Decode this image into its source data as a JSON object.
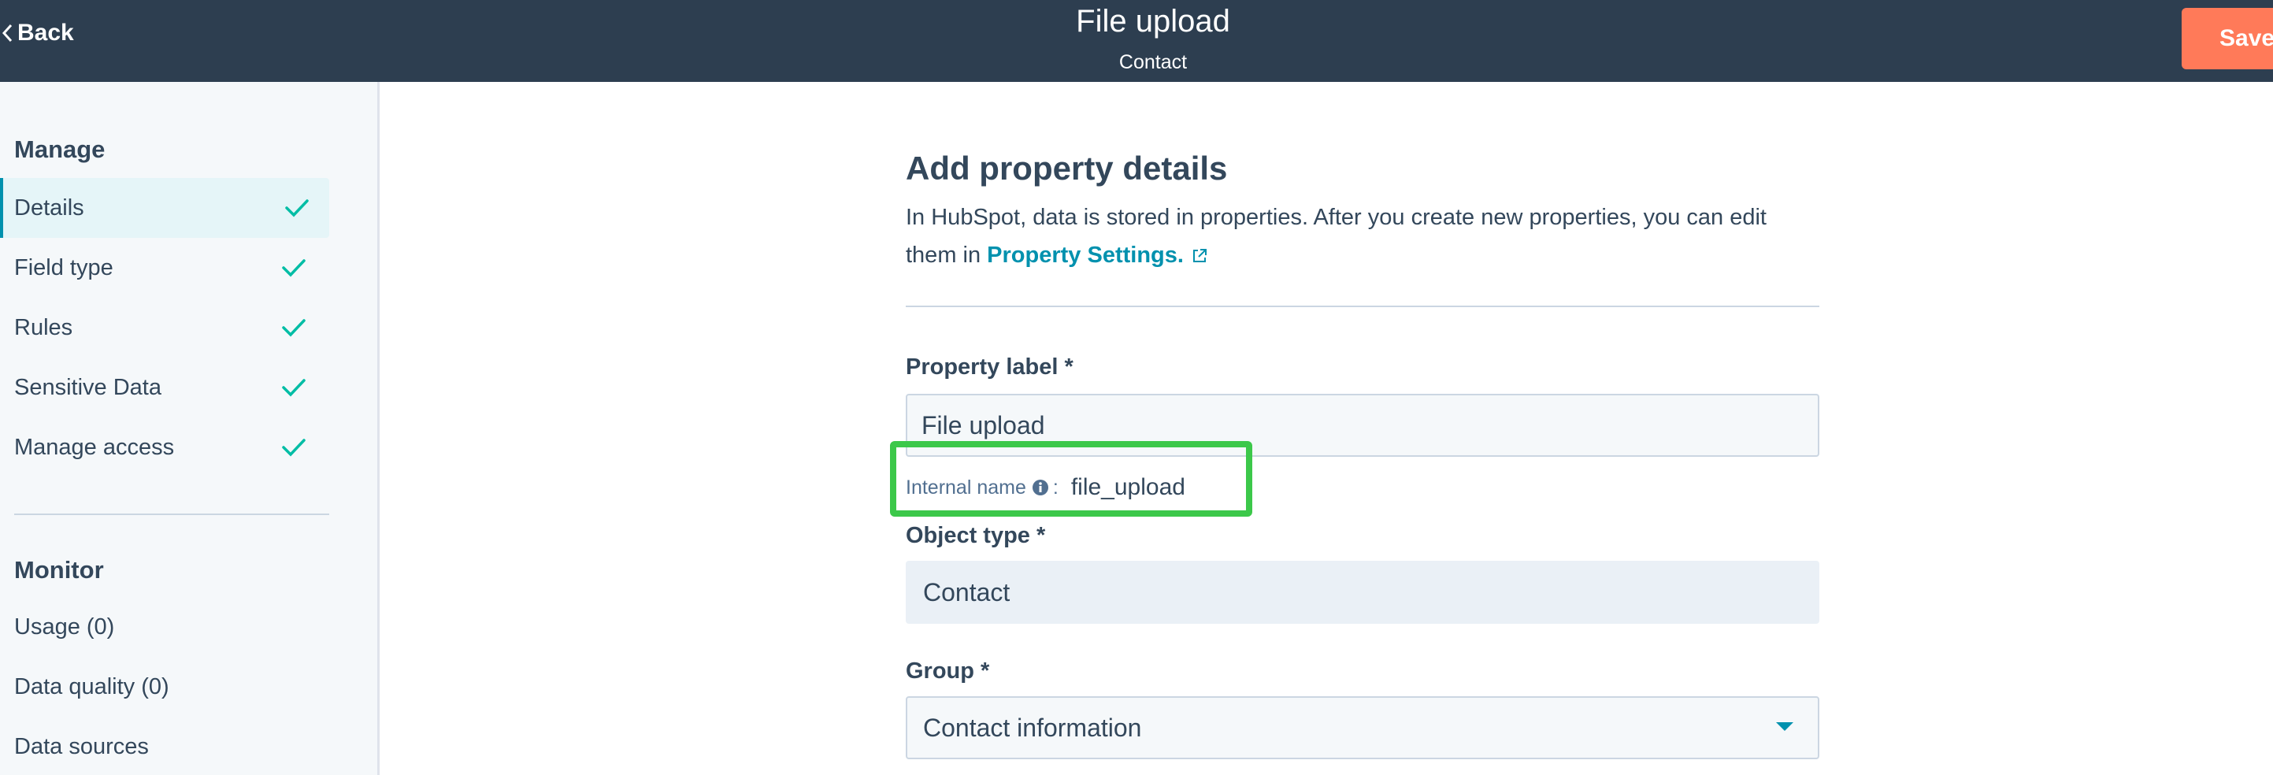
{
  "header": {
    "back_label": "Back",
    "title": "File upload",
    "subtitle": "Contact",
    "save_label": "Save"
  },
  "sidebar": {
    "manage_title": "Manage",
    "manage_items": [
      {
        "label": "Details",
        "active": true,
        "done": true
      },
      {
        "label": "Field type",
        "done": true
      },
      {
        "label": "Rules",
        "done": true
      },
      {
        "label": "Sensitive Data",
        "done": true
      },
      {
        "label": "Manage access",
        "done": true
      }
    ],
    "monitor_title": "Monitor",
    "monitor_items": [
      {
        "label": "Usage (0)"
      },
      {
        "label": "Data quality (0)"
      },
      {
        "label": "Data sources"
      }
    ]
  },
  "main": {
    "heading": "Add property details",
    "description_prefix": "In HubSpot, data is stored in properties. After you create new properties, you can edit them in ",
    "description_link": "Property Settings.",
    "property_label": {
      "label": "Property label *",
      "value": "File upload"
    },
    "internal_name": {
      "label": "Internal name",
      "colon": ":",
      "value": "file_upload"
    },
    "object_type": {
      "label": "Object type *",
      "value": "Contact"
    },
    "group": {
      "label": "Group *",
      "value": "Contact information"
    }
  },
  "colors": {
    "header_bg": "#2d3e50",
    "save_bg": "#ff7a59",
    "accent": "#0091ae",
    "check": "#00bda5",
    "highlight": "#3cc84a"
  },
  "icons": [
    "chevron-left-icon",
    "check-icon",
    "external-link-icon",
    "info-icon",
    "caret-down-icon"
  ]
}
